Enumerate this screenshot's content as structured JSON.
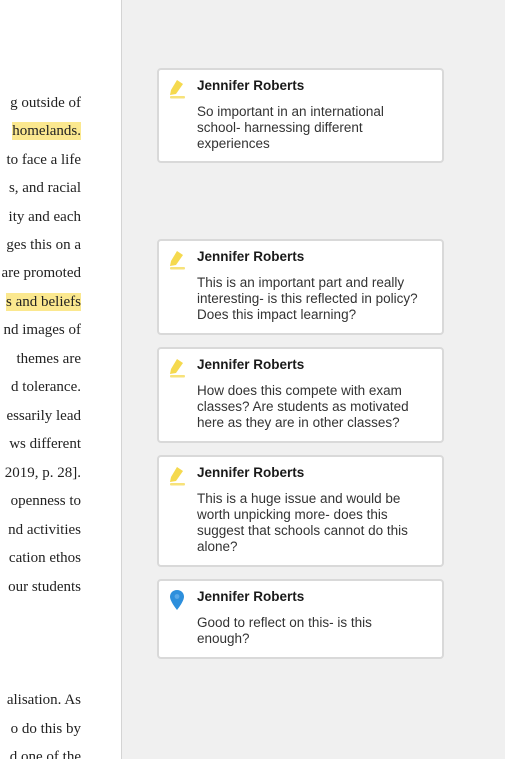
{
  "document": {
    "lines": [
      {
        "text": "g outside of",
        "highlight": false
      },
      {
        "text": " homelands.",
        "highlight": true
      },
      {
        "text": "to face a life",
        "highlight": false
      },
      {
        "text": "s, and racial",
        "highlight": false
      },
      {
        "text": "ity and each",
        "highlight": false
      },
      {
        "text": "ges this on a",
        "highlight": false
      },
      {
        "text": "are promoted",
        "highlight": false
      },
      {
        "text": "s and beliefs",
        "highlight": true
      },
      {
        "text": "nd images of",
        "highlight": false
      },
      {
        "text": " themes  are",
        "highlight": false
      },
      {
        "text": "d tolerance.",
        "highlight": false
      },
      {
        "text": "essarily lead",
        "highlight": false
      },
      {
        "text": "ws different",
        "highlight": false
      },
      {
        "text": "2019, p. 28].",
        "highlight": false
      },
      {
        "text": " openness to",
        "highlight": false
      },
      {
        "text": "nd activities",
        "highlight": false
      },
      {
        "text": "cation ethos",
        "highlight": false
      },
      {
        "text": "our students",
        "highlight": false
      },
      {
        "text": "alisation. As",
        "highlight": false
      },
      {
        "text": "o do this by",
        "highlight": false
      },
      {
        "text": "d one of the",
        "highlight": false
      }
    ]
  },
  "comments": [
    {
      "author": "Jennifer Roberts",
      "type": "highlight",
      "icon": "pencil-highlight-icon",
      "icon_color": "#f5d94e",
      "text": "So important in an international school- harnessing different experiences"
    },
    {
      "author": "Jennifer Roberts",
      "type": "highlight",
      "icon": "pencil-highlight-icon",
      "icon_color": "#f5d94e",
      "text": "This is an important part and really interesting- is this reflected in policy? Does this impact learning?"
    },
    {
      "author": "Jennifer Roberts",
      "type": "highlight",
      "icon": "pencil-highlight-icon",
      "icon_color": "#f5d94e",
      "text": "How does this compete with exam classes? Are students as motivated here as they are in other classes?"
    },
    {
      "author": "Jennifer Roberts",
      "type": "highlight",
      "icon": "pencil-highlight-icon",
      "icon_color": "#f5d94e",
      "text": "This is a huge issue and would be worth unpicking more- does this suggest that schools cannot do this alone?"
    },
    {
      "author": "Jennifer Roberts",
      "type": "note",
      "icon": "map-pin-icon",
      "icon_color": "#2d8fdc",
      "text": "Good to reflect on this- is this enough?"
    }
  ]
}
